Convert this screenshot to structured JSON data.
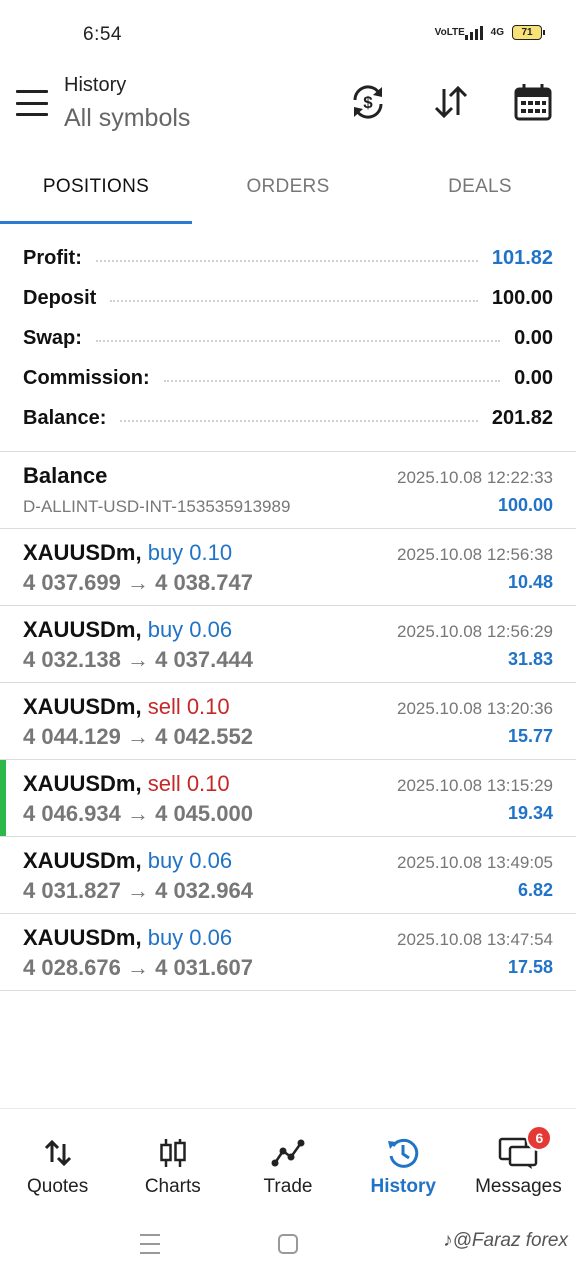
{
  "status_bar": {
    "time": "6:54",
    "volte": "VoLTE",
    "network": "4G",
    "battery": "71"
  },
  "app_bar": {
    "title": "History",
    "subtitle": "All symbols",
    "icons": [
      "currency-refresh-icon",
      "sort-icon",
      "calendar-icon"
    ]
  },
  "tabs": [
    {
      "label": "POSITIONS",
      "active": true
    },
    {
      "label": "ORDERS",
      "active": false
    },
    {
      "label": "DEALS",
      "active": false
    }
  ],
  "summary": {
    "profit": {
      "label": "Profit:",
      "value": "101.82"
    },
    "deposit": {
      "label": "Deposit",
      "value": "100.00"
    },
    "swap": {
      "label": "Swap:",
      "value": "0.00"
    },
    "commission": {
      "label": "Commission:",
      "value": "0.00"
    },
    "balance": {
      "label": "Balance:",
      "value": "201.82"
    }
  },
  "balance_entry": {
    "title": "Balance",
    "comment": "D-ALLINT-USD-INT-153535913989",
    "time": "2025.10.08 12:22:33",
    "amount": "100.00"
  },
  "positions": [
    {
      "symbol": "XAUUSDm,",
      "type": "buy 0.10",
      "side": "buy",
      "prices": "4 037.699 → 4 038.747",
      "time": "2025.10.08 12:56:38",
      "profit": "10.48"
    },
    {
      "symbol": "XAUUSDm,",
      "type": "buy 0.06",
      "side": "buy",
      "prices": "4 032.138 → 4 037.444",
      "time": "2025.10.08 12:56:29",
      "profit": "31.83"
    },
    {
      "symbol": "XAUUSDm,",
      "type": "sell 0.10",
      "side": "sell",
      "prices": "4 044.129 → 4 042.552",
      "time": "2025.10.08 13:20:36",
      "profit": "15.77"
    },
    {
      "symbol": "XAUUSDm,",
      "type": "sell 0.10",
      "side": "sell",
      "prices": "4 046.934 → 4 045.000",
      "time": "2025.10.08 13:15:29",
      "profit": "19.34"
    },
    {
      "symbol": "XAUUSDm,",
      "type": "buy 0.06",
      "side": "buy",
      "prices": "4 031.827 → 4 032.964",
      "time": "2025.10.08 13:49:05",
      "profit": "6.82"
    },
    {
      "symbol": "XAUUSDm,",
      "type": "buy 0.06",
      "side": "buy",
      "prices": "4 028.676 → 4 031.607",
      "time": "2025.10.08 13:47:54",
      "profit": "17.58"
    }
  ],
  "bottom_nav": {
    "quotes": "Quotes",
    "charts": "Charts",
    "trade": "Trade",
    "history": "History",
    "messages": "Messages",
    "messages_badge": "6"
  },
  "watermark": "@Faraz forex",
  "colors": {
    "accent": "#2173c7",
    "sell": "#c62828",
    "marker": "#2eb84a"
  }
}
